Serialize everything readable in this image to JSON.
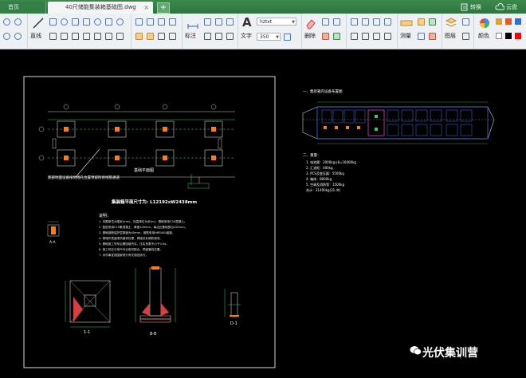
{
  "tabs": {
    "home_label": "首页",
    "active_label": "40尺储能集装箱基础图.dwg",
    "close_glyph": "×",
    "add_glyph": "+"
  },
  "top_right": {
    "convert_label": "转换",
    "cloud_label": "云盘"
  },
  "ribbon": {
    "straight_line_label": "直线",
    "annotation_label": "标注",
    "text_label": "文字",
    "delete_label": "删除",
    "measure_label": "测量",
    "layer_label": "图层",
    "color_label": "颜色",
    "font_value": "hztxt",
    "size_value": "350",
    "swatch_colors": [
      "#d9a43c",
      "#e35a2a",
      "#2f6fd1",
      "#ffffff",
      "#000000",
      "#ff0000"
    ]
  },
  "drawing": {
    "plan_title": "基础平面图",
    "plan_note": "底部地面设备接地线孔位置预留检修线管通道",
    "dims_title": "集装箱平面尺寸为: L12192xW2438mm",
    "notes_heading": "说明：",
    "notes": [
      "1. 本图单位为毫米(mm)，标高单位为米(m)，基础采用C30混凝土。",
      "2. 垫层采用C15素混凝土，厚度100mm，每边比基础宽出100mm。",
      "3. 基础钢筋保护层厚度为40mm，钢筋采用HRB400级钢。",
      "4. 预埋件表面须热镀锌处理，焊接处补刷防锈漆。",
      "5. 基础施工完毕后需回填夯实，压实系数不小于0.94。",
      "6. 施工时应与电气专业密切配合，预留管线位置。",
      "7. 未尽事宜按国家现行有关规范执行。"
    ],
    "section_a": "A-A",
    "section_1": "1-1",
    "section_b": "B-B",
    "section_d": "D-1",
    "layout_title": "一、集装箱内设备布置图",
    "weights_heading": "二、重量：",
    "weights": [
      "1. 电池簇：2000kg×8=16000kg",
      "2. 汇流柜：400kg",
      "3. PCS及变压器：5500kg",
      "4. 箱体：8000kg",
      "5. 空调及消防等：1500kg",
      "   合计：31400kg(31.4t)"
    ]
  },
  "watermark": {
    "text": "光伏集训营"
  }
}
